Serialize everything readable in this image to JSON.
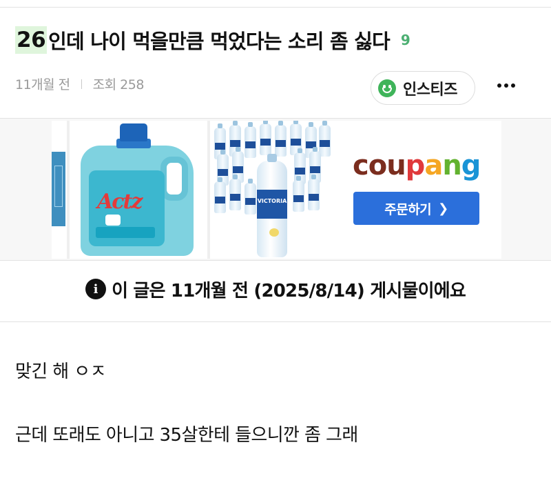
{
  "post": {
    "title_highlight": "26",
    "title_rest": "인데 나이 먹을만큼 먹었다는 소리 좀 싫다",
    "comment_count": "9",
    "time_ago": "11개월 전",
    "views": "조회 258",
    "board_chip": "인스티즈",
    "more_icon": "more-horizontal-icon"
  },
  "ad": {
    "brand": [
      "cou",
      "p",
      "a",
      "n",
      "g"
    ],
    "button_label": "주문하기",
    "button_icon": "chevron-right-icon",
    "products": [
      "detergent-bottle",
      "water-bottles"
    ],
    "detergent_logo": "Actz",
    "water_label": "VICTORIA",
    "colors": {
      "brand_blue": "#2b6fdb",
      "brand_brown": "#7b2d1e",
      "brand_red": "#e0393b",
      "brand_yellow": "#f5a623",
      "brand_green": "#62b22f",
      "brand_sky": "#1a94d6"
    }
  },
  "notice": {
    "icon": "info-icon",
    "icon_glyph": "i",
    "text": "이 글은 11개월 전 (2025/8/14) 게시물이에요"
  },
  "content": {
    "lines": [
      "맞긴 해 ㅇㅈ",
      "근데 또래도 아니고 35살한테 들으니깐 좀 그래"
    ]
  },
  "colors": {
    "highlight_bg": "#dff5dc",
    "comment_count": "#4caf72",
    "chip_icon": "#3fb45a",
    "meta_text": "#9a9a9a"
  }
}
